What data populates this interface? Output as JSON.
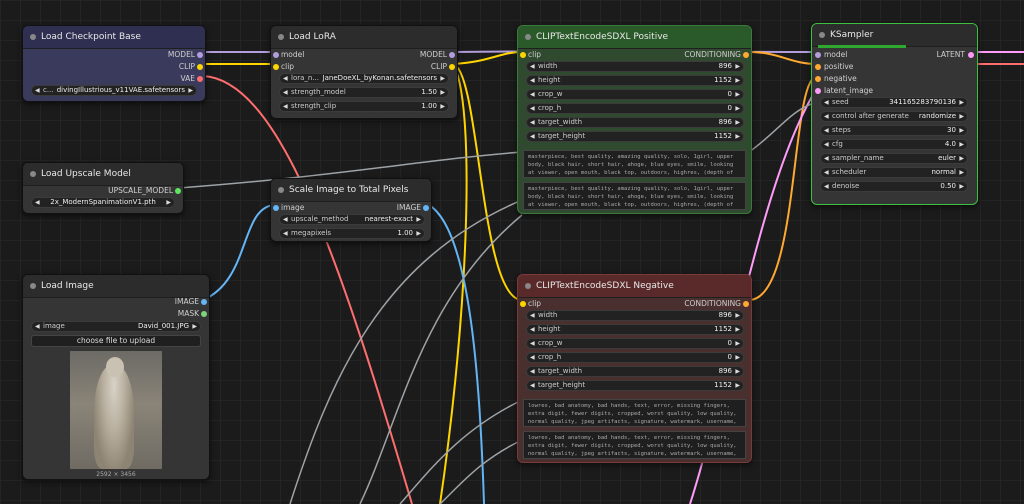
{
  "colors": {
    "model": "#b39ddb",
    "clip": "#ffd500",
    "vae": "#ff6e6e",
    "conditioning": "#ffa931",
    "latent": "#ff9cf9",
    "image": "#64b5f6",
    "upscale": "#5ce75c",
    "mask": "#7ed47e"
  },
  "nodes": {
    "load_checkpoint": {
      "title": "Load Checkpoint Base",
      "outputs": [
        "MODEL",
        "CLIP",
        "VAE"
      ],
      "ckpt_label": "c...",
      "ckpt_value": "divingIllustrious_v11VAE.safetensors"
    },
    "load_lora": {
      "title": "Load LoRA",
      "inputs": [
        "model",
        "clip"
      ],
      "outputs": [
        "MODEL",
        "CLIP"
      ],
      "widgets": [
        {
          "label": "lora_n...",
          "value": "JaneDoeXL_byKonan.safetensors"
        },
        {
          "label": "strength_model",
          "value": "1.50"
        },
        {
          "label": "strength_clip",
          "value": "1.00"
        }
      ]
    },
    "clip_pos": {
      "title": "CLIPTextEncodeSDXL Positive",
      "input": "clip",
      "output": "CONDITIONING",
      "widgets": [
        {
          "label": "width",
          "value": "896"
        },
        {
          "label": "height",
          "value": "1152"
        },
        {
          "label": "crop_w",
          "value": "0"
        },
        {
          "label": "crop_h",
          "value": "0"
        },
        {
          "label": "target_width",
          "value": "896"
        },
        {
          "label": "target_height",
          "value": "1152"
        }
      ],
      "text_g": "masterpiece, best quality, amazing quality, solo, 1girl, upper body, black hair, short hair, ahoge, blue eyes, smile, looking at viewer, open mouth, black top, outdoors, highres, (depth of",
      "text_l": "masterpiece, best quality, amazing quality, solo, 1girl, upper body, black hair, short hair, ahoge, blue eyes, smile, looking at viewer, open mouth, black top, outdoors, highres, (depth of"
    },
    "ksampler": {
      "title": "KSampler",
      "inputs": [
        "model",
        "positive",
        "negative",
        "latent_image"
      ],
      "output": "LATENT",
      "widgets": [
        {
          "label": "seed",
          "value": "341165283790136"
        },
        {
          "label": "control after generate",
          "value": "randomize"
        },
        {
          "label": "steps",
          "value": "30"
        },
        {
          "label": "cfg",
          "value": "4.0"
        },
        {
          "label": "sampler_name",
          "value": "euler"
        },
        {
          "label": "scheduler",
          "value": "normal"
        },
        {
          "label": "denoise",
          "value": "0.50"
        }
      ]
    },
    "load_upscale": {
      "title": "Load Upscale Model",
      "output": "UPSCALE_MODEL",
      "value": "2x_ModernSpanimationV1.pth"
    },
    "scale_image": {
      "title": "Scale Image to Total Pixels",
      "input": "image",
      "output": "IMAGE",
      "widgets": [
        {
          "label": "upscale_method",
          "value": "nearest-exact"
        },
        {
          "label": "megapixels",
          "value": "1.00"
        }
      ]
    },
    "load_image": {
      "title": "Load Image",
      "outputs": [
        "IMAGE",
        "MASK"
      ],
      "image_label": "image",
      "image_value": "David_001.JPG",
      "upload": "choose file to upload",
      "dims": "2592 × 3456"
    },
    "clip_neg": {
      "title": "CLIPTextEncodeSDXL Negative",
      "input": "clip",
      "output": "CONDITIONING",
      "widgets": [
        {
          "label": "width",
          "value": "896"
        },
        {
          "label": "height",
          "value": "1152"
        },
        {
          "label": "crop_w",
          "value": "0"
        },
        {
          "label": "crop_h",
          "value": "0"
        },
        {
          "label": "target_width",
          "value": "896"
        },
        {
          "label": "target_height",
          "value": "1152"
        }
      ],
      "text_g": "lowres, bad anatomy, bad hands, text, error, missing fingers, extra digit, fewer digits, cropped, worst quality, low quality, normal quality, jpeg artifacts, signature, watermark, username,",
      "text_l": "lowres, bad anatomy, bad hands, text, error, missing fingers, extra digit, fewer digits, cropped, worst quality, low quality, normal quality, jpeg artifacts, signature, watermark, username,"
    }
  }
}
